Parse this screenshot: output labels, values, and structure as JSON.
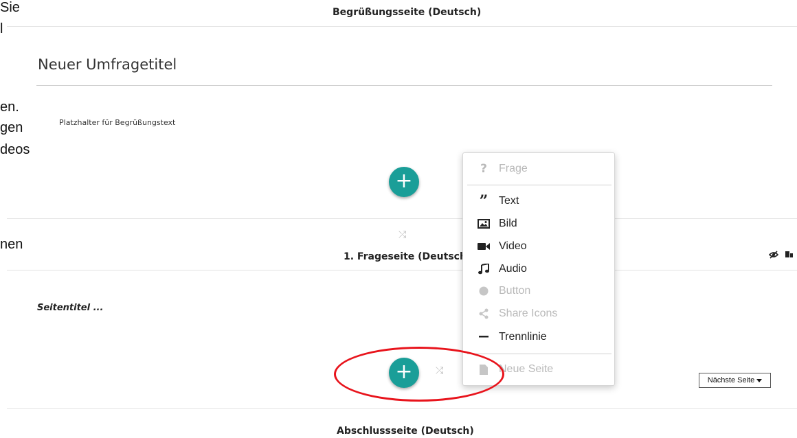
{
  "background_fragments": [
    {
      "text": "Sie"
    },
    {
      "text": "l"
    },
    {
      "text": "en."
    },
    {
      "text": "gen"
    },
    {
      "text": "deos"
    },
    {
      "text": "nen"
    }
  ],
  "welcome_section": {
    "header": "Begrüßungsseite (Deutsch)",
    "survey_title": "Neuer Umfragetitel",
    "welcome_placeholder": "Platzhalter für Begrüßungstext",
    "add_label": "+"
  },
  "question_section": {
    "header": "1. Frageseite (Deutsch",
    "page_title": "Seitentitel ...",
    "add_label": "+",
    "next_page_select": "Nächste Seite"
  },
  "closing_section": {
    "header": "Abschlussseite (Deutsch)"
  },
  "add_menu": {
    "items": [
      {
        "label": "Frage",
        "icon": "question-mark-icon",
        "enabled": false
      },
      {
        "label": "Text",
        "icon": "quote-icon",
        "enabled": true
      },
      {
        "label": "Bild",
        "icon": "image-icon",
        "enabled": true
      },
      {
        "label": "Video",
        "icon": "video-camera-icon",
        "enabled": true
      },
      {
        "label": "Audio",
        "icon": "music-note-icon",
        "enabled": true
      },
      {
        "label": "Button",
        "icon": "circle-icon",
        "enabled": false
      },
      {
        "label": "Share Icons",
        "icon": "share-icon",
        "enabled": false
      },
      {
        "label": "Trennlinie",
        "icon": "horizontal-rule-icon",
        "enabled": true
      },
      {
        "label": "Neue Seite",
        "icon": "file-icon",
        "enabled": false
      }
    ]
  },
  "colors": {
    "accent": "#1a9e98",
    "highlight": "#e8141c",
    "disabled": "#b9b9b9"
  }
}
